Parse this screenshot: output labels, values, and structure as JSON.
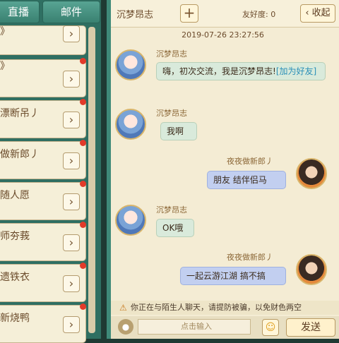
{
  "tabs": [
    "直播",
    "邮件"
  ],
  "contacts": [
    {
      "label": "》"
    },
    {
      "label": "漂断吊丿"
    },
    {
      "label": "做新郎丿"
    },
    {
      "label": "随人愿"
    },
    {
      "label": "师夯莪"
    },
    {
      "label": "遗铁衣"
    },
    {
      "label": "新烧鸭"
    }
  ],
  "header": {
    "title": "沉梦昂志",
    "add_label": "+",
    "friendship_label": "友好度:",
    "friendship_value": "0",
    "collapse_label": "‹ 收起"
  },
  "timestamp": "2019-07-26 23:27:56",
  "messages": [
    {
      "sender": "沉梦昂志",
      "text": "嗨，初次交流，我是沉梦昂志!",
      "link": "[加为好友]"
    },
    {
      "sender": "沉梦昂志",
      "text": "我啊"
    },
    {
      "sender": "夜夜做新郎丿",
      "text": "朋友 结伴侣马"
    },
    {
      "sender": "沉梦昂志",
      "text": "OK哦"
    },
    {
      "sender": "夜夜做新郎丿",
      "text": "一起云游江湖 搞不搞"
    }
  ],
  "notice": {
    "icon": "warning-icon",
    "text": "你正在与陌生人聊天，请提防被骗，以免财色两空"
  },
  "input": {
    "placeholder": "点击输入",
    "send_label": "发送",
    "emoji_icon": "emoji-icon",
    "voice_icon": "microphone-icon"
  }
}
